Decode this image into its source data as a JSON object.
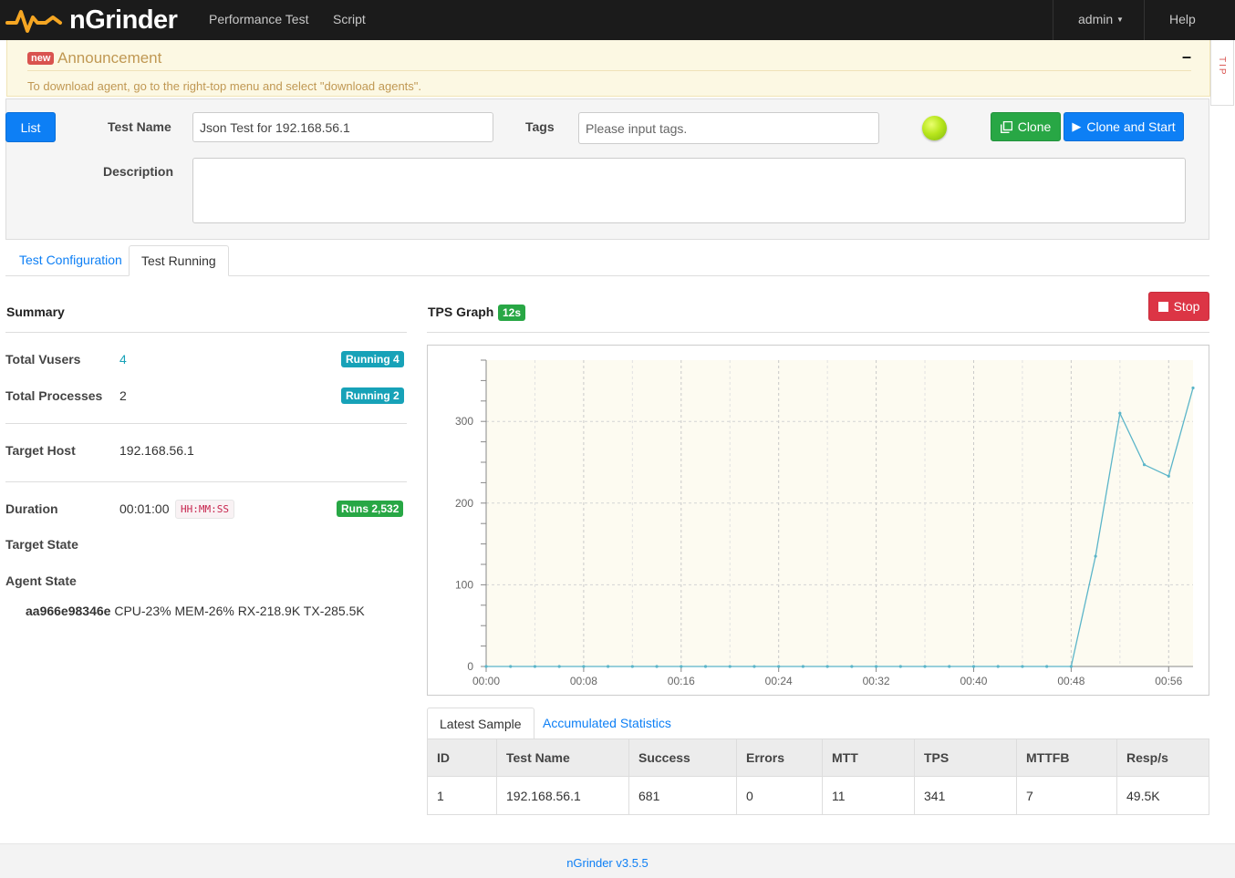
{
  "nav": {
    "brand": "nGrinder",
    "items": [
      "Performance Test",
      "Script"
    ],
    "user": "admin",
    "help": "Help"
  },
  "announcement": {
    "badge": "new",
    "title": "Announcement",
    "text": "To download agent, go to the right-top menu and select \"download agents\".",
    "minimize": "–",
    "tip": "TIP"
  },
  "form": {
    "list_button": "List",
    "test_name_label": "Test Name",
    "test_name_value": "Json Test for 192.168.56.1",
    "tags_label": "Tags",
    "tags_placeholder": "Please input tags.",
    "description_label": "Description",
    "description_value": "",
    "clone_button": "Clone",
    "clone_start_button": "Clone and Start"
  },
  "tabs": [
    "Test Configuration",
    "Test Running"
  ],
  "summary": {
    "title": "Summary",
    "total_vusers_label": "Total Vusers",
    "total_vusers_value": "4",
    "vusers_badge": "Running 4",
    "total_processes_label": "Total Processes",
    "total_processes_value": "2",
    "processes_badge": "Running 2",
    "target_host_label": "Target Host",
    "target_host_value": "192.168.56.1",
    "duration_label": "Duration",
    "duration_value": "00:01:00",
    "duration_format": "HH:MM:SS",
    "runs_badge": "Runs 2,532",
    "target_state_label": "Target State",
    "agent_state_label": "Agent State",
    "agent_id": "aa966e98346e",
    "agent_stats": " CPU-23% MEM-26% RX-218.9K TX-285.5K"
  },
  "tps": {
    "title": "TPS Graph",
    "interval_badge": "12s",
    "stop_button": "Stop"
  },
  "chart_data": {
    "type": "line",
    "x": [
      "00:00",
      "00:02",
      "00:04",
      "00:06",
      "00:08",
      "00:10",
      "00:12",
      "00:14",
      "00:16",
      "00:18",
      "00:20",
      "00:22",
      "00:24",
      "00:26",
      "00:28",
      "00:30",
      "00:32",
      "00:34",
      "00:36",
      "00:38",
      "00:40",
      "00:42",
      "00:44",
      "00:46",
      "00:48",
      "00:50",
      "00:52",
      "00:54",
      "00:56",
      "00:58"
    ],
    "series": [
      {
        "values": [
          0,
          0,
          0,
          0,
          0,
          0,
          0,
          0,
          0,
          0,
          0,
          0,
          0,
          0,
          0,
          0,
          0,
          0,
          0,
          0,
          0,
          0,
          0,
          0,
          0,
          135,
          310,
          247,
          233,
          341
        ]
      }
    ],
    "x_tick_labels": [
      "00:00",
      "00:08",
      "00:16",
      "00:24",
      "00:32",
      "00:40",
      "00:48",
      "00:56"
    ],
    "y_tick_labels": [
      "0",
      "100",
      "200",
      "300"
    ],
    "ylim": [
      0,
      375
    ],
    "grid": true,
    "line_color": "#5bb5c9",
    "plot_background": "#fdfbf1"
  },
  "sample_tabs": [
    "Latest Sample",
    "Accumulated Statistics"
  ],
  "sample_table": {
    "columns": [
      "ID",
      "Test Name",
      "Success",
      "Errors",
      "MTT",
      "TPS",
      "MTTFB",
      "Resp/s"
    ],
    "rows": [
      [
        "1",
        "192.168.56.1",
        "681",
        "0",
        "11",
        "341",
        "7",
        "49.5K"
      ]
    ]
  },
  "footer": {
    "version": "nGrinder v3.5.5"
  }
}
